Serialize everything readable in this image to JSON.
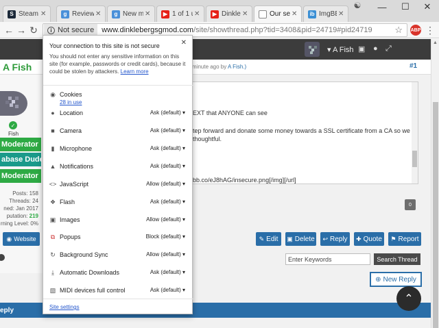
{
  "tabs": [
    {
      "label": "Steam C",
      "favicon_color": "#1b2838",
      "favicon": "steam-icon"
    },
    {
      "label": "Reviews",
      "favicon_color": "#4a90d9",
      "favicon": "g-icon"
    },
    {
      "label": "New me",
      "favicon_color": "#4a90d9",
      "favicon": "g-icon"
    },
    {
      "label": "1 of 1 u",
      "favicon_color": "#e62117",
      "favicon": "youtube-icon"
    },
    {
      "label": "Dinkleb",
      "favicon_color": "#e62117",
      "favicon": "youtube-icon"
    },
    {
      "label": "Our sec",
      "favicon_color": "#ffffff",
      "favicon": "page-icon"
    },
    {
      "label": "ImgBB -",
      "favicon_color": "#3b8fd4",
      "favicon": "imgbb-icon"
    }
  ],
  "omnibox": {
    "security_label": "Not secure",
    "url_host": "www.dinklebergsgmod.com",
    "url_path": "/site/showthread.php?tid=3408&pid=24719#pid24719"
  },
  "extension_badge": "ABP",
  "site": {
    "user": "A Fish",
    "post_author": "A Fish",
    "post_time": "minute ago by",
    "post_time_by": "A Fish.)",
    "post_number": "#1",
    "sidebar_name": "Fish",
    "roles": [
      {
        "label": "Moderator",
        "color": "#2eaa44"
      },
      {
        "label": "abase Dude",
        "color": "#1a9a8a"
      },
      {
        "label": "Moderator",
        "color": "#2eaa44"
      }
    ],
    "stats": {
      "posts": "Posts: 158",
      "threads": "Threads: 24",
      "joined": "ned: Jan 2017",
      "reputation_label": "putation:",
      "reputation_value": "219",
      "warning": "rning Level: 0%"
    },
    "website_label": "Website",
    "editor_lines": [
      "EXT that ANYONE can see",
      "tep forward and donate some money towards a SSL certificate from a CA  so we",
      "thoughtful.",
      "bb.co/eJ8hAG/insecure.png[/img][/url]"
    ],
    "char_counter": "0",
    "actions": {
      "edit": "Edit",
      "delete": "Delete",
      "reply": "Reply",
      "quote": "Quote",
      "report": "Report"
    },
    "search_placeholder": "Enter Keywords",
    "search_button": "Search Thread",
    "new_reply": "New Reply",
    "bottom_bar": "eply"
  },
  "popup": {
    "title": "Your connection to this site is not secure",
    "description": "You should not enter any sensitive information on this site (for example, passwords or credit cards), because it could be stolen by attackers.",
    "learn_more": "Learn more",
    "cookies_label": "Cookies",
    "cookies_link": "28 in use",
    "permissions": [
      {
        "label": "Location",
        "value": "Ask (default)",
        "icon": "location-icon"
      },
      {
        "label": "Camera",
        "value": "Ask (default)",
        "icon": "camera-icon"
      },
      {
        "label": "Microphone",
        "value": "Ask (default)",
        "icon": "microphone-icon"
      },
      {
        "label": "Notifications",
        "value": "Ask (default)",
        "icon": "bell-icon"
      },
      {
        "label": "JavaScript",
        "value": "Allow (default)",
        "icon": "code-icon"
      },
      {
        "label": "Flash",
        "value": "Ask (default)",
        "icon": "puzzle-icon"
      },
      {
        "label": "Images",
        "value": "Allow (default)",
        "icon": "image-icon"
      },
      {
        "label": "Popups",
        "value": "Block (default)",
        "icon": "popup-icon"
      },
      {
        "label": "Background Sync",
        "value": "Allow (default)",
        "icon": "sync-icon"
      },
      {
        "label": "Automatic Downloads",
        "value": "Ask (default)",
        "icon": "download-icon"
      },
      {
        "label": "MIDI devices full control",
        "value": "Ask (default)",
        "icon": "midi-icon"
      }
    ],
    "site_settings": "Site settings"
  }
}
